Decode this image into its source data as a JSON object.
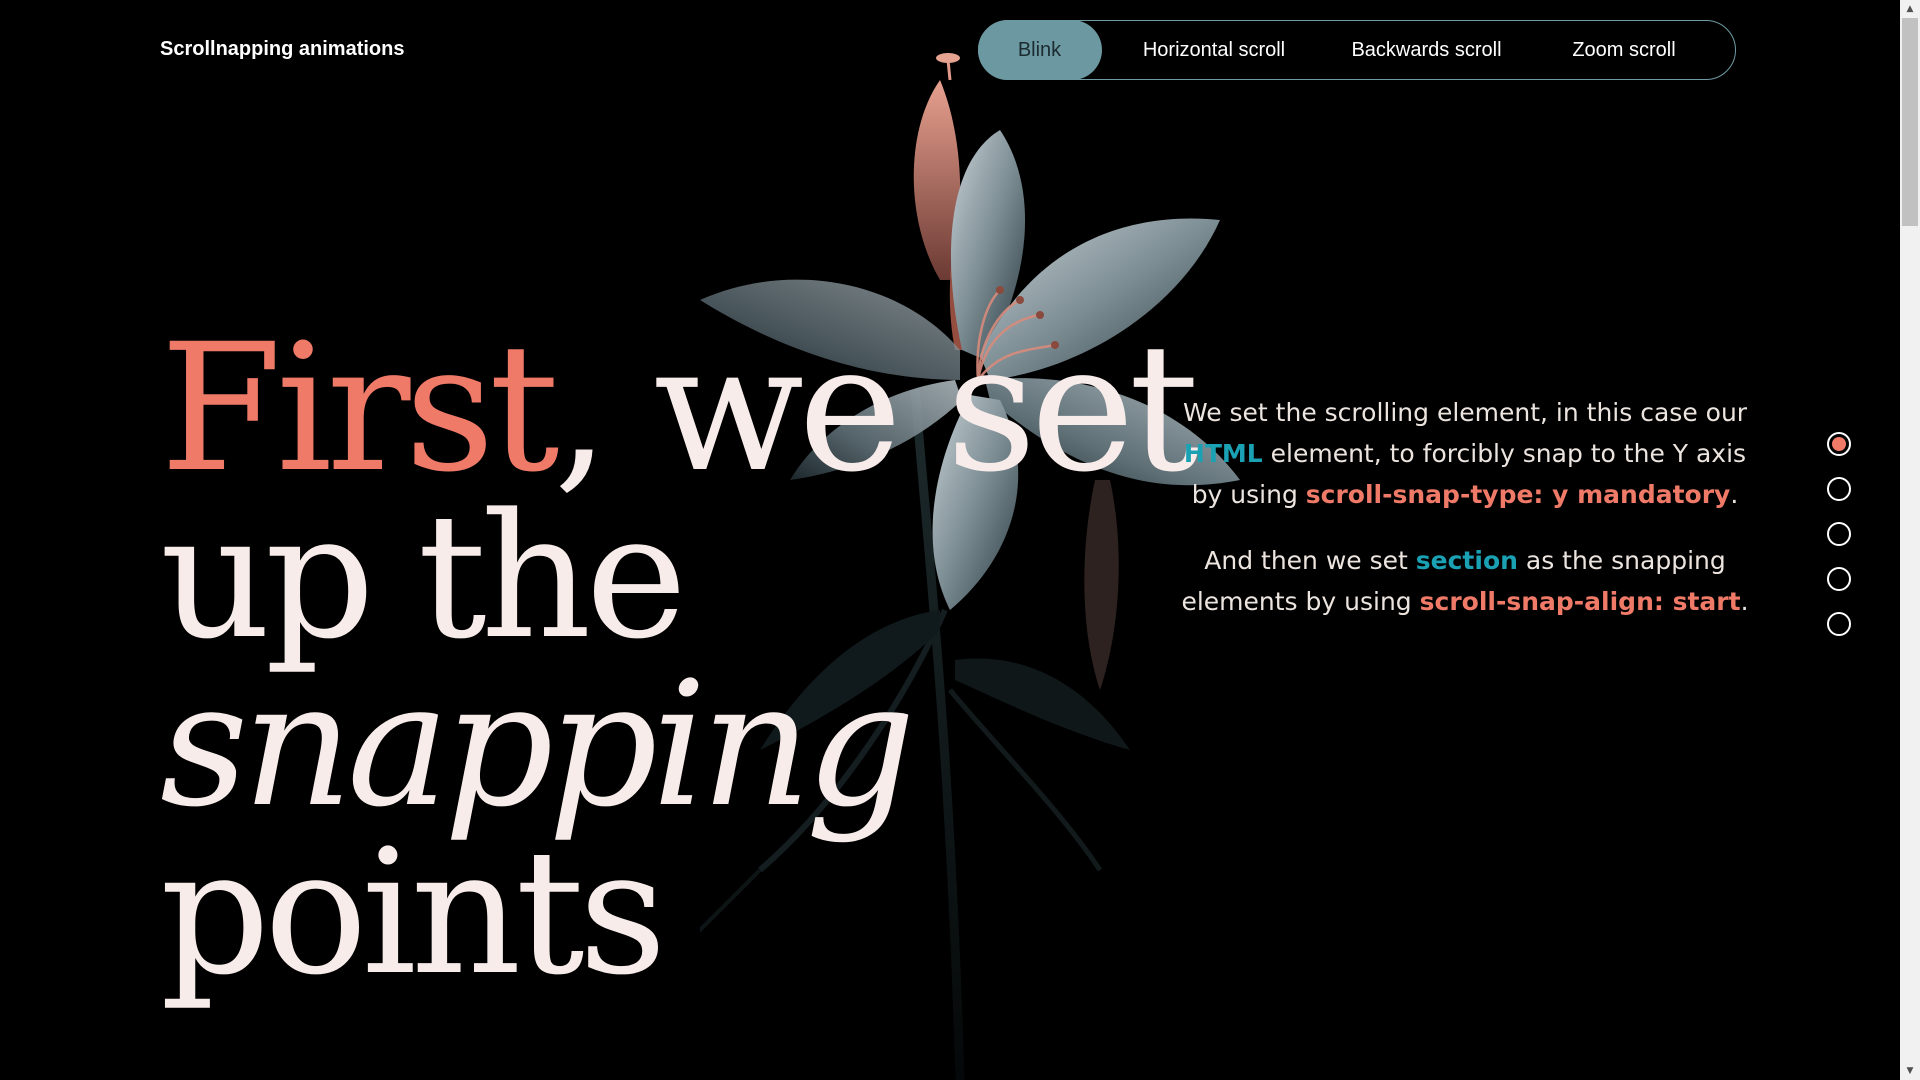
{
  "header": {
    "brand": "Scrollnapping animations"
  },
  "nav": {
    "items": [
      {
        "label": "Blink",
        "active": true
      },
      {
        "label": "Horizontal scroll",
        "active": false
      },
      {
        "label": "Backwards scroll",
        "active": false
      },
      {
        "label": "Zoom scroll",
        "active": false
      }
    ]
  },
  "headline": {
    "first": "First",
    "rest_line1": ", we set",
    "line2": "up the",
    "line3": "snapping",
    "line4": "points"
  },
  "description": {
    "p1_a": "We set the scrolling element, in this case our ",
    "p1_html": "HTML",
    "p1_b": " element, to forcibly snap to the Y axis by using ",
    "p1_code": "scroll-snap-type: y mandatory",
    "p1_c": ".",
    "p2_a": "And then we set ",
    "p2_section": "section",
    "p2_b": " as the snapping elements by using ",
    "p2_code": "scroll-snap-align: start",
    "p2_c": "."
  },
  "pagination": {
    "count": 5,
    "active_index": 0
  },
  "colors": {
    "accent_coral": "#f07a68",
    "accent_teal": "#1aa1b3",
    "nav_active": "#6b98a1",
    "background": "#000000"
  }
}
